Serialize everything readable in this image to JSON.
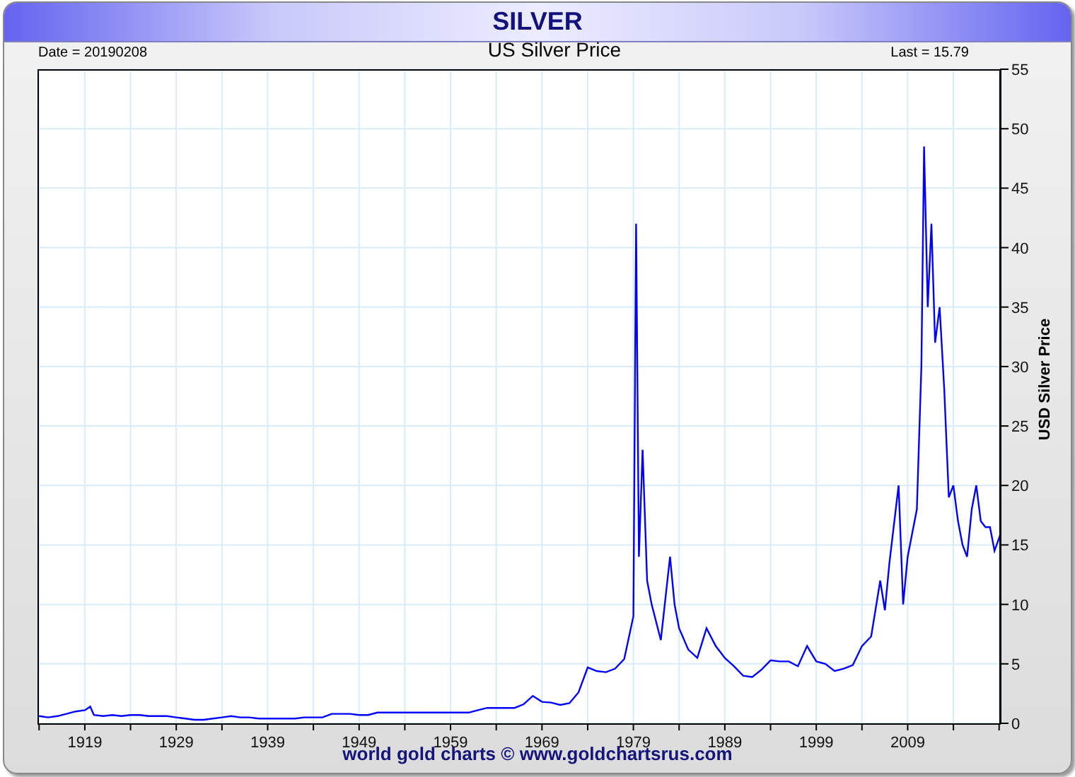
{
  "header": {
    "title": "SILVER"
  },
  "chart": {
    "date_label": "Date = 20190208",
    "last_label": "Last = 15.79",
    "chart_data": {
      "type": "line",
      "title": "US Silver Price",
      "ylabel": "USD Silver Price",
      "xlim": [
        1913.9,
        2019.1
      ],
      "ylim": [
        0,
        55
      ],
      "xticks": [
        1919,
        1929,
        1939,
        1949,
        1959,
        1969,
        1979,
        1989,
        1999,
        2009
      ],
      "yticks": [
        0,
        5,
        10,
        15,
        20,
        25,
        30,
        35,
        40,
        45,
        50,
        55
      ],
      "x": [
        1914,
        1915,
        1916,
        1917,
        1918,
        1919,
        1919.6,
        1920,
        1921,
        1922,
        1923,
        1924,
        1925,
        1926,
        1927,
        1928,
        1929,
        1930,
        1931,
        1932,
        1933,
        1934,
        1935,
        1936,
        1937,
        1938,
        1939,
        1940,
        1941,
        1942,
        1943,
        1944,
        1945,
        1946,
        1947,
        1948,
        1949,
        1950,
        1951,
        1952,
        1953,
        1954,
        1955,
        1956,
        1957,
        1958,
        1959,
        1960,
        1961,
        1962,
        1963,
        1964,
        1965,
        1966,
        1967,
        1968,
        1969,
        1970,
        1971,
        1972,
        1973,
        1974,
        1975,
        1976,
        1977,
        1978,
        1979,
        1979.3,
        1979.6,
        1980,
        1980.5,
        1981,
        1982,
        1983,
        1983.5,
        1984,
        1985,
        1986,
        1987,
        1988,
        1989,
        1990,
        1991,
        1992,
        1993,
        1994,
        1995,
        1996,
        1997,
        1998,
        1999,
        2000,
        2001,
        2002,
        2003,
        2004,
        2005,
        2006,
        2006.5,
        2007,
        2008,
        2008.5,
        2009,
        2010,
        2010.5,
        2010.8,
        2011.2,
        2011.6,
        2012,
        2012.5,
        2013,
        2013.5,
        2014,
        2014.5,
        2015,
        2015.5,
        2016,
        2016.5,
        2017,
        2017.5,
        2018,
        2018.5,
        2019.1
      ],
      "grid": true,
      "series": [
        {
          "color": "#0000ff",
          "values": [
            0.6,
            0.5,
            0.6,
            0.8,
            1,
            1.1,
            1.4,
            0.7,
            0.6,
            0.7,
            0.6,
            0.7,
            0.7,
            0.6,
            0.6,
            0.6,
            0.5,
            0.4,
            0.3,
            0.3,
            0.4,
            0.5,
            0.6,
            0.5,
            0.5,
            0.4,
            0.4,
            0.4,
            0.4,
            0.4,
            0.5,
            0.5,
            0.5,
            0.8,
            0.8,
            0.8,
            0.7,
            0.7,
            0.9,
            0.9,
            0.9,
            0.9,
            0.9,
            0.9,
            0.9,
            0.9,
            0.9,
            0.9,
            0.9,
            1.1,
            1.3,
            1.3,
            1.3,
            1.3,
            1.6,
            2.3,
            1.8,
            1.75,
            1.55,
            1.7,
            2.6,
            4.7,
            4.4,
            4.3,
            4.6,
            5.4,
            9,
            42,
            14,
            23,
            12,
            10,
            7,
            14,
            10,
            8,
            6.2,
            5.5,
            8,
            6.5,
            5.5,
            4.8,
            4,
            3.9,
            4.5,
            5.3,
            5.2,
            5.2,
            4.8,
            6.5,
            5.2,
            5,
            4.4,
            4.6,
            4.9,
            6.5,
            7.3,
            12,
            9.5,
            13.5,
            20,
            10,
            14,
            18,
            30,
            48.5,
            35,
            42,
            32,
            35,
            28,
            19,
            20,
            17,
            15,
            14,
            18,
            20,
            17,
            16.5,
            16.5,
            14.5,
            15.8
          ]
        }
      ]
    }
  },
  "footer": {
    "text": "world gold charts © www.goldchartsrus.com"
  }
}
